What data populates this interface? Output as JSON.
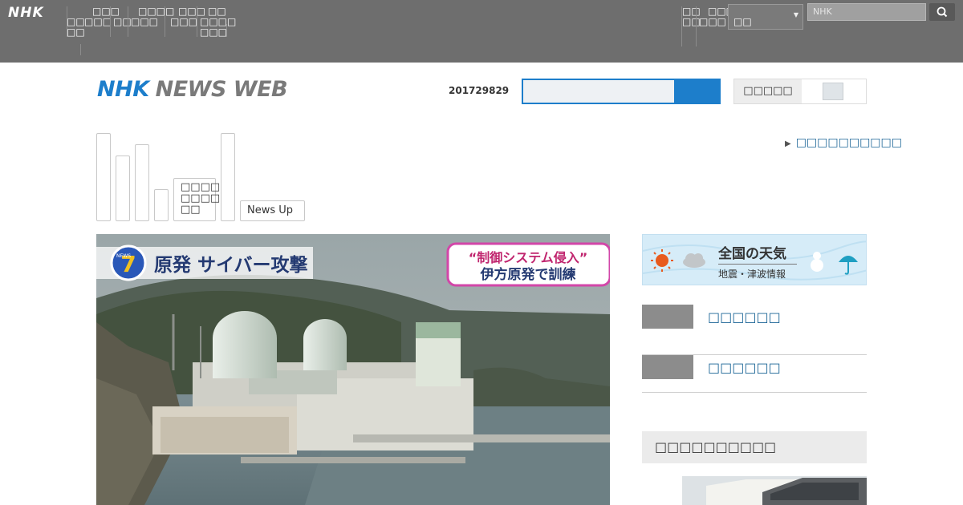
{
  "global_nav": {
    "logo": "NHK",
    "left_items": [
      {
        "lines": [
          "",
          "",
          "□□",
          "□□"
        ],
        "x": 0
      },
      {
        "lines": [
          "□□□",
          "□□□"
        ]
      },
      {
        "lines": [
          "",
          "□□"
        ]
      },
      {
        "lines": [
          "□□□□",
          "□□□"
        ]
      },
      {
        "lines": [
          "□□□",
          "□□□"
        ]
      },
      {
        "lines": [
          "□□",
          "□□□□",
          "□□□"
        ]
      }
    ],
    "right_items": [
      {
        "lines": [
          "□□",
          "□□"
        ]
      },
      {
        "lines": [
          "□□□",
          "□□□"
        ]
      }
    ],
    "region_value": "□□",
    "search_placeholder": "NHK",
    "search_icon": "magnifier-icon"
  },
  "header": {
    "logo_nhk": "NHK",
    "logo_newsweb": "NEWS WEB",
    "date": "201729829",
    "search_value": "",
    "subtitle_toggle_label": "□□□□□"
  },
  "tabs": [
    {
      "label": ""
    },
    {
      "label": ""
    },
    {
      "label": ""
    },
    {
      "label": ""
    },
    {
      "label": "□□□□\n□□□□\n□□"
    },
    {
      "label": ""
    },
    {
      "label": "News Up"
    }
  ],
  "ranking_link": "□□□□□□□□□□",
  "hero": {
    "logo_number": "7",
    "logo_small": "NEWS",
    "headline": "原発 サイバー攻撃",
    "caption_line1": "“制御システム侵入”",
    "caption_line2": "伊方原発で訓練"
  },
  "weather_banner": {
    "title": "全国の天気",
    "subtitle": "地震・津波情報"
  },
  "side_links": [
    {
      "label": "□□□□□□"
    },
    {
      "label": "□□□□□□"
    }
  ],
  "side_section_title": "□□□□□□□□□□",
  "colors": {
    "topbar": "#6e6e6e",
    "brand_blue": "#1d7ecb",
    "link_blue": "#1a6496"
  }
}
